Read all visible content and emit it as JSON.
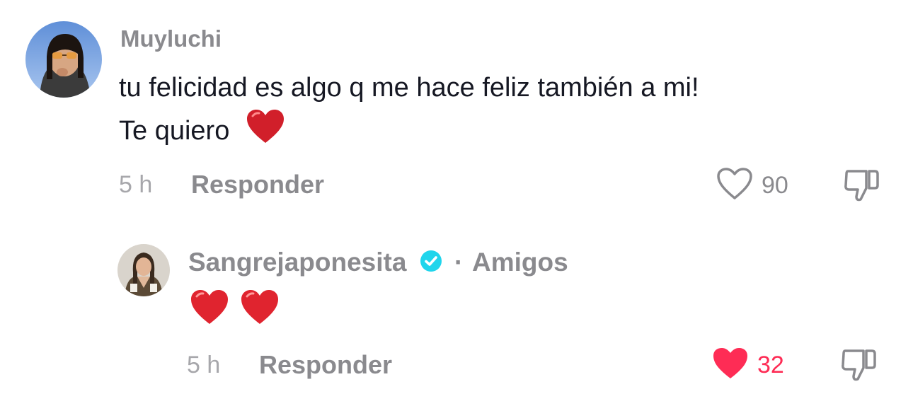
{
  "comment": {
    "username": "Muyluchi",
    "text_line1": "tu felicidad es algo q me hace feliz también a mi!",
    "text_line2": "Te quiero",
    "time": "5 h",
    "reply_label": "Responder",
    "like_count": "90",
    "liked": false
  },
  "reply": {
    "username": "Sangrejaponesita",
    "verified": true,
    "separator": "·",
    "relation": "Amigos",
    "time": "5 h",
    "reply_label": "Responder",
    "like_count": "32",
    "liked": true
  },
  "colors": {
    "username": "#8a8a8e",
    "text": "#161823",
    "liked": "#fe2c55",
    "verified": "#20d5ec",
    "emoji_heart": "#e0242f"
  },
  "icons": [
    "heart-outline-icon",
    "heart-filled-icon",
    "thumbs-down-icon",
    "verified-badge-icon",
    "red-heart-emoji"
  ]
}
